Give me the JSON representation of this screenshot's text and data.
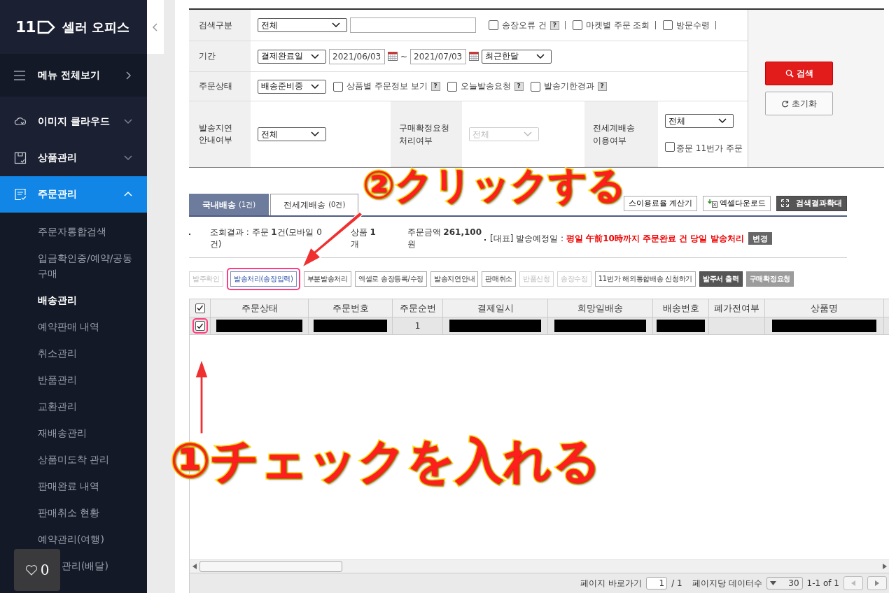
{
  "sidebar": {
    "logo_number": "11",
    "logo_text": "셀러 오피스",
    "menu_all": "메뉴 전체보기",
    "sections": [
      {
        "label": "이미지 클라우드",
        "kind": "cloud",
        "expanded": false,
        "selected": false
      },
      {
        "label": "상품관리",
        "kind": "box",
        "expanded": false,
        "selected": false
      },
      {
        "label": "주문관리",
        "kind": "document",
        "expanded": true,
        "selected": true
      }
    ],
    "sub_items": [
      {
        "label": "주문자통합검색",
        "selected": false
      },
      {
        "label": "입금확인중/예약/공동구매",
        "selected": false
      },
      {
        "label": "배송관리",
        "selected": true
      },
      {
        "label": "예약판매 내역",
        "selected": false
      },
      {
        "label": "취소관리",
        "selected": false
      },
      {
        "label": "반품관리",
        "selected": false
      },
      {
        "label": "교환관리",
        "selected": false
      },
      {
        "label": "재배송관리",
        "selected": false
      },
      {
        "label": "상품미도착 관리",
        "selected": false
      },
      {
        "label": "판매완료 내역",
        "selected": false
      },
      {
        "label": "판매취소 현황",
        "selected": false
      },
      {
        "label": "예약관리(여행)",
        "selected": false
      },
      {
        "label": "관리(배달)",
        "selected": false,
        "covered": true
      }
    ]
  },
  "like_widget": {
    "count": "0"
  },
  "search_form": {
    "search_type": {
      "label": "검색구분",
      "select": "전체",
      "checks": [
        {
          "label": "송장오류 건",
          "help": "?",
          "checked": false
        },
        {
          "label": "마켓별 주문 조회",
          "checked": false
        },
        {
          "label": "방문수령",
          "checked": false
        }
      ]
    },
    "period": {
      "label": "기간",
      "select": "결제완료일",
      "from": "2021/06/03",
      "tilde": "~",
      "to": "2021/07/03",
      "range": "최근한달"
    },
    "order_status": {
      "label": "주문상태",
      "select": "배송준비중",
      "checks": [
        {
          "label": "상품별 주문정보 보기",
          "help": "?",
          "checked": false
        },
        {
          "label": "오늘발송요청",
          "help": "?",
          "checked": false
        },
        {
          "label": "발송기한경과",
          "help": "?",
          "checked": false
        }
      ]
    },
    "delay_notice": {
      "label": "발송지연 안내여부",
      "select": "전체",
      "disabled": false
    },
    "purchase_confirm": {
      "label": "구매확정요청 처리여부",
      "select": "전체",
      "disabled": true
    },
    "global_shipping": {
      "label": "전세계배송 이용여부",
      "select": "전체",
      "check": {
        "label": "중문 11번가 주문",
        "checked": false
      }
    },
    "search_button": "검색",
    "reset_button": "초기화"
  },
  "tabs": [
    {
      "label": "국내배송",
      "count": "(1건)",
      "selected": true
    },
    {
      "label": "전세계배송",
      "count": "(0건)",
      "selected": false
    }
  ],
  "tool_buttons": [
    {
      "label": "스이용료율 계산기",
      "kind": "plain"
    },
    {
      "label": "엑셀다운로드",
      "kind": "excel"
    },
    {
      "label": "검색결과확대",
      "kind": "expand"
    }
  ],
  "summary": {
    "left": [
      "조회결과 : 주문 **1**건(모바일 0건)",
      "상품 **1**개",
      "주문금액 **261,100**원"
    ],
    "right_label": "[대표] 발송예정일 :",
    "right_value": "평일 午前10時까지 주문완료 건 당일 발송처리",
    "change_button": "변경"
  },
  "action_buttons": [
    {
      "label": "발주확인",
      "kind": "disabled",
      "highlighted": false
    },
    {
      "label": "발송처리(송장입력)",
      "kind": "primary",
      "highlighted": true
    },
    {
      "label": "부분발송처리",
      "kind": "normal",
      "highlighted": false
    },
    {
      "label": "엑셀로 송장등록/수정",
      "kind": "normal",
      "highlighted": false
    },
    {
      "label": "발송지연안내",
      "kind": "normal",
      "highlighted": false
    },
    {
      "label": "판매취소",
      "kind": "normal",
      "highlighted": false
    },
    {
      "label": "반품신청",
      "kind": "disabled",
      "highlighted": false
    },
    {
      "label": "송장수정",
      "kind": "disabled",
      "highlighted": false
    },
    {
      "label": "11번가 해외통합배송 신청하기",
      "kind": "normal",
      "highlighted": false
    },
    {
      "label": "발주서 출력",
      "kind": "dark",
      "highlighted": false
    },
    {
      "label": "구매확정요청",
      "kind": "gray",
      "highlighted": false
    }
  ],
  "table": {
    "header_checked": true,
    "columns": [
      "주문상태",
      "주문번호",
      "주문순번",
      "결제일시",
      "희망일배송",
      "배송번호",
      "폐가전여부",
      "상품명"
    ],
    "rows": [
      {
        "checked": true,
        "highlighted": true,
        "cells": [
          {
            "redacted": true
          },
          {
            "redacted": true
          },
          {
            "text": "1"
          },
          {
            "redacted": true
          },
          {
            "redacted": true
          },
          {
            "redacted": true
          },
          {
            "text": ""
          },
          {
            "redacted": true
          }
        ]
      }
    ]
  },
  "pagination": {
    "goto_label": "페이지 바로가기",
    "page": "1",
    "total": "/ 1",
    "per_page_label": "페이지당 데이터수",
    "per_page": "30",
    "range": "1-1 of 1"
  },
  "annotations": [
    {
      "text": "②クリックする"
    },
    {
      "text": "①チェックを入れる"
    }
  ]
}
